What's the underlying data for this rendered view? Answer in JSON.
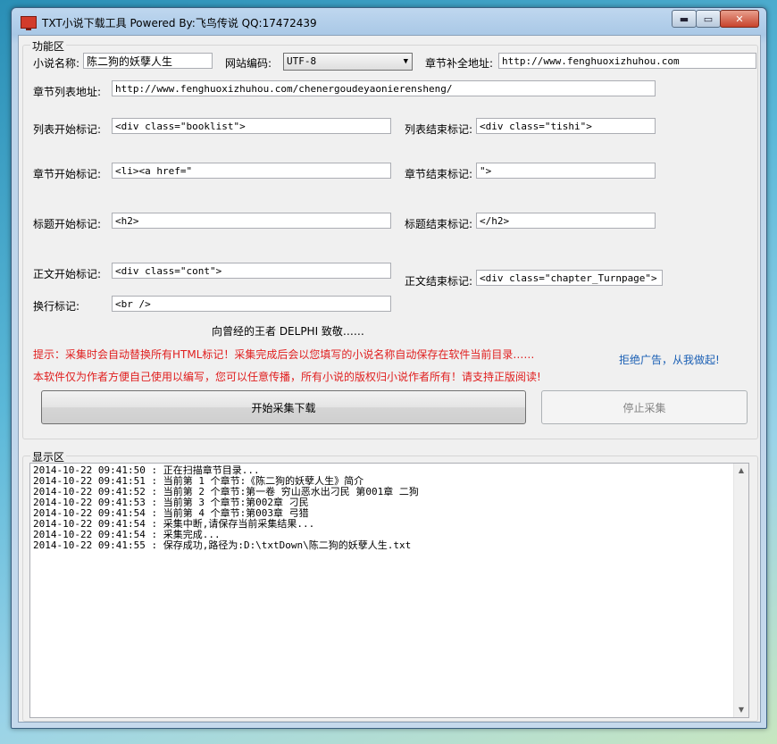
{
  "window": {
    "title": "TXT小说下载工具 Powered By:飞鸟传说 QQ:17472439",
    "min_label": "▬",
    "max_label": "▭",
    "close_label": "✕"
  },
  "function_area": {
    "title": "功能区",
    "novel_name_label": "小说名称:",
    "novel_name_value": "陈二狗的妖孽人生",
    "encoding_label": "网站编码:",
    "encoding_value": "UTF-8",
    "base_url_label": "章节补全地址:",
    "base_url_value": "http://www.fenghuoxizhuhou.com",
    "chapter_list_url_label": "章节列表地址:",
    "chapter_list_url_value": "http://www.fenghuoxizhuhou.com/chenergoudeyaonierensheng/",
    "list_start_label": "列表开始标记:",
    "list_start_value": "<div class=\"booklist\">",
    "list_end_label": "列表结束标记:",
    "list_end_value": "<div class=\"tishi\">",
    "chapter_start_label": "章节开始标记:",
    "chapter_start_value": "<li><a href=\"",
    "chapter_end_label": "章节结束标记:",
    "chapter_end_value": "\">",
    "title_start_label": "标题开始标记:",
    "title_start_value": "<h2>",
    "title_end_label": "标题结束标记:",
    "title_end_value": "</h2>",
    "body_start_label": "正文开始标记:",
    "body_start_value": "<div class=\"cont\">",
    "body_end_label": "正文结束标记:",
    "body_end_value": "<div class=\"chapter_Turnpage\">",
    "newline_label": "换行标记:",
    "newline_value": "<br />",
    "tribute": "向曾经的王者  DELPHI  致敬……",
    "tip1": "提示：采集时会自动替换所有HTML标记！采集完成后会以您填写的小说名称自动保存在软件当前目录……",
    "tip2": "本软件仅为作者方便自己使用以编写，您可以任意传播，所有小说的版权归小说作者所有！请支持正版阅读!",
    "no_ads": "拒绝广告，从我做起!",
    "start_button": "开始采集下载",
    "stop_button": "停止采集"
  },
  "display_area": {
    "title": "显示区",
    "log": [
      "2014-10-22 09:41:50 : 正在扫描章节目录...",
      "2014-10-22 09:41:51 : 当前第 1 个章节:《陈二狗的妖孽人生》简介",
      "2014-10-22 09:41:52 : 当前第 2 个章节:第一卷 穷山恶水出刁民 第001章 二狗",
      "2014-10-22 09:41:53 : 当前第 3 个章节:第002章 刁民",
      "2014-10-22 09:41:54 : 当前第 4 个章节:第003章 弓猎",
      "2014-10-22 09:41:54 : 采集中断,请保存当前采集结果...",
      "2014-10-22 09:41:54 : 采集完成...",
      "2014-10-22 09:41:55 : 保存成功,路径为:D:\\txtDown\\陈二狗的妖孽人生.txt"
    ]
  }
}
